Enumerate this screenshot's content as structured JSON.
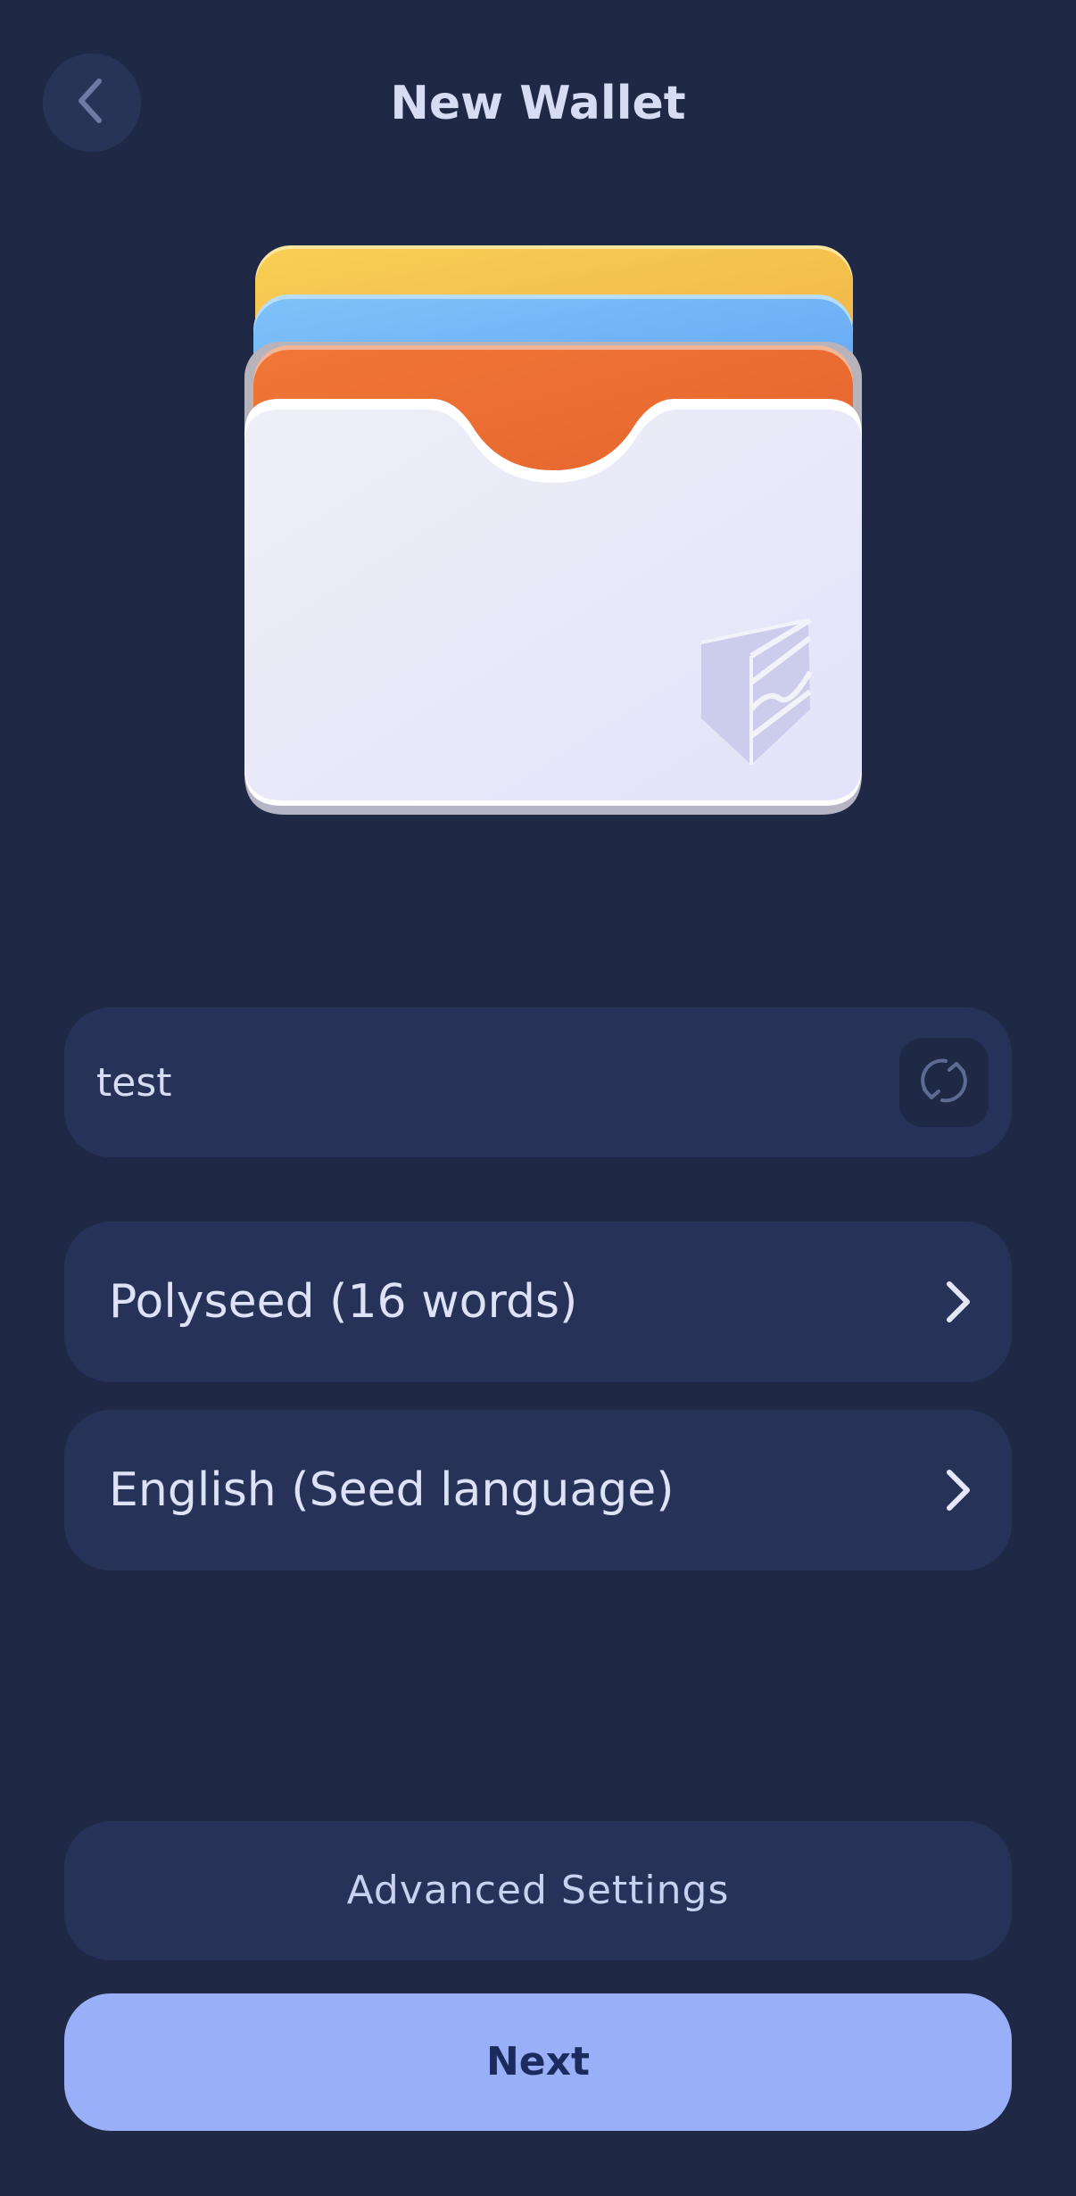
{
  "header": {
    "title": "New Wallet",
    "back_icon": "chevron-left-icon"
  },
  "wallet_name": {
    "value": "test",
    "refresh_icon": "refresh-icon"
  },
  "seed_type": {
    "label": "Polyseed (16 words)",
    "icon": "chevron-right-icon"
  },
  "seed_language": {
    "label": "English (Seed language)",
    "icon": "chevron-right-icon"
  },
  "actions": {
    "advanced_label": "Advanced Settings",
    "next_label": "Next"
  },
  "colors": {
    "background": "#1f2945",
    "surface": "#263258",
    "primary_button": "#99aff8",
    "card_yellow": "#f5c94f",
    "card_blue": "#6aaef7",
    "card_orange": "#e8692f"
  }
}
